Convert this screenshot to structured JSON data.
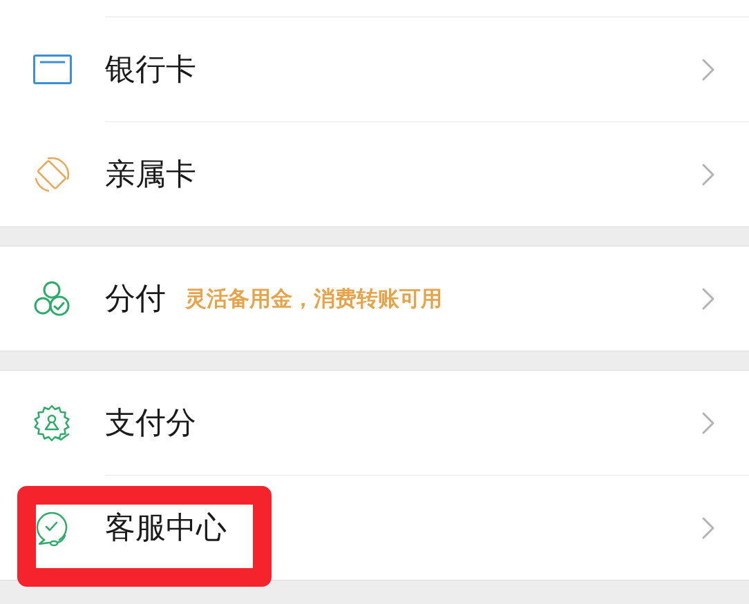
{
  "sections": [
    {
      "items": [
        {
          "label": "银行卡",
          "highlighted": false
        },
        {
          "label": "亲属卡",
          "highlighted": false
        }
      ]
    },
    {
      "items": [
        {
          "label": "分付",
          "subtitle": "灵活备用金，消费转账可用",
          "highlighted": false
        }
      ]
    },
    {
      "items": [
        {
          "label": "支付分",
          "highlighted": false
        },
        {
          "label": "客服中心",
          "highlighted": true
        }
      ]
    }
  ]
}
